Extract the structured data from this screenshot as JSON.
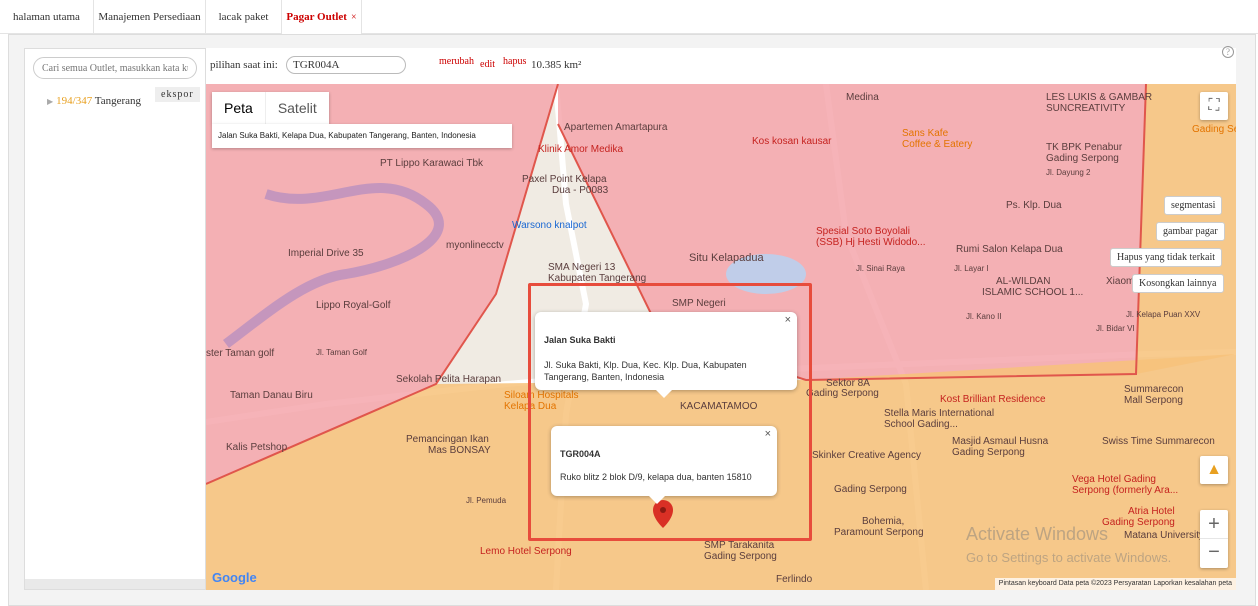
{
  "tabs": [
    {
      "label": "halaman utama"
    },
    {
      "label": "Manajemen Persediaan"
    },
    {
      "label": "lacak paket"
    },
    {
      "label": "Pagar Outlet",
      "close": "×"
    }
  ],
  "sidebar": {
    "search_placeholder": "Cari semua Outlet, masukkan kata ku",
    "export_label": "ekspor",
    "tree_item": {
      "arrow": "▶",
      "count": "194/347",
      "name": "Tangerang"
    }
  },
  "toolbar": {
    "current_label": "pilihan saat ini:",
    "current_value": "TGR004A",
    "change_label": "merubah",
    "edit_label": "edit",
    "delete_label": "hapus",
    "area_value": "10.385 km²",
    "help": "?"
  },
  "map": {
    "type_options": [
      {
        "label": "Peta"
      },
      {
        "label": "Satelit"
      }
    ],
    "address_box": "Jalan Suka Bakti, Kelapa Dua, Kabupaten Tangerang, Banten, Indonesia",
    "labels": {
      "apartemen": "Apartemen Amartapura",
      "medina": "Medina",
      "les_lukis_1": "LES LUKIS & GAMBAR",
      "les_lukis_2": "SUNCREATIVITY",
      "gading_top": "Gading Se",
      "klinik": "Klinik Amor Medika",
      "kos": "Kos kosan kausar",
      "sans_1": "Sans Kafe",
      "sans_2": "Coffee & Eatery",
      "tkbpk_1": "TK BPK Penabur",
      "tkbpk_2": "Gading Serpong",
      "lippo": "PT Lippo Karawaci Tbk",
      "paxel_1": "Paxel Point Kelapa",
      "paxel_2": "Dua - P0083",
      "jl_dayung": "Jl. Dayung 2",
      "warsono": "Warsono knalpot",
      "ps_klp": "Ps. Klp. Dua",
      "spesial_1": "Spesial Soto Boyolali",
      "spesial_2": "(SSB) Hj Hesti Widodo...",
      "myonline": "myonlinecctv",
      "imperial": "Imperial Drive 35",
      "sma_1": "SMA Negeri 13",
      "sma_2": "Kabupaten Tangerang",
      "situ": "Situ Kelapadua",
      "rumi": "Rumi Salon Kelapa Dua",
      "jl_sinai": "Jl. Sinai Raya",
      "jl_layar": "Jl. Layar I",
      "alwildan_1": "AL-WILDAN",
      "alwildan_2": "ISLAMIC SCHOOL 1...",
      "xiaomi": "Xiaomi",
      "lippo_golf": "Lippo Royal-Golf",
      "smp_1": "SMP Negeri",
      "master_golf": "ster Taman golf",
      "jl_taman_golf": "Jl. Taman Golf",
      "sekolah": "Sekolah Pelita Harapan",
      "taman_danau": "Taman Danau Biru",
      "siloam_1": "Siloam Hospitals",
      "siloam_2": "Kelapa Dua",
      "kacamata": "KACAMATAMOO",
      "sektor_1": "Sektor 8A",
      "sektor_2": "Gading Serpong",
      "kost": "Kost Brilliant Residence",
      "summarecon_1": "Summarecon",
      "summarecon_2": "Mall Serpong",
      "stella_1": "Stella Maris International",
      "stella_2": "School Gading...",
      "kalis": "Kalis Petshop",
      "pemancingan_1": "Pemancingan Ikan",
      "pemancingan_2": "Mas BONSAY",
      "skinker": "Skinker Creative Agency",
      "masjid_1": "Masjid Asmaul Husna",
      "masjid_2": "Gading Serpong",
      "swiss": "Swiss Time Summarecon",
      "gading_serpong": "Gading Serpong",
      "vega_1": "Vega Hotel Gading",
      "vega_2": "Serpong (formerly Ara...",
      "jl_pemuda": "Jl. Pemuda",
      "bohemia_1": "Bohemia,",
      "bohemia_2": "Paramount Serpong",
      "atria_1": "Atria Hotel",
      "atria_2": "Gading Serpong",
      "matana": "Matana University",
      "lemo": "Lemo Hotel Serpong",
      "smpt_1": "SMP Tarakanita",
      "smpt_2": "Gading Serpong",
      "ferlindo": "Ferlindo",
      "jl_bidar": "Jl. Bidar VI",
      "jl_kelapa": "Jl. Kelapa Puan XXV",
      "jl_kano": "Jl. Kano II"
    },
    "popup_street": {
      "title": "Jalan Suka Bakti",
      "text": "Jl. Suka Bakti, Klp. Dua, Kec. Klp. Dua, Kabupaten Tangerang, Banten, Indonesia",
      "close": "×"
    },
    "popup_outlet": {
      "title": "TGR004A",
      "text": "Ruko blitz 2 blok D/9, kelapa dua, banten 15810",
      "close": "×"
    },
    "fullscreen": "⛶",
    "zoom_in": "+",
    "zoom_out": "−",
    "google": "Google",
    "footer": "Pintasan keyboard   Data peta ©2023   Persyaratan   Laporkan kesalahan peta",
    "activate_1": "Activate Windows",
    "activate_2": "Go to Settings to activate Windows."
  },
  "side_buttons": [
    {
      "label": "segmentasi"
    },
    {
      "label": "gambar pagar"
    },
    {
      "label": "Hapus yang tidak terkait"
    },
    {
      "label": "Kosongkan lainnya"
    }
  ],
  "colors": {
    "accent_red": "#cc0000",
    "zone_pink": "#f4a6ab",
    "zone_orange": "#f7c27a",
    "highlight_box": "#e74c3c",
    "marker_red": "#d93025"
  }
}
